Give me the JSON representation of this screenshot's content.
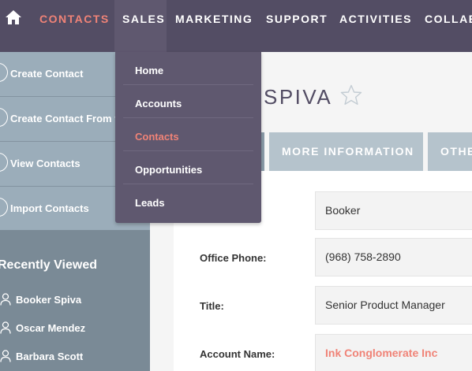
{
  "nav": {
    "items": [
      {
        "label": "CONTACTS"
      },
      {
        "label": "SALES"
      },
      {
        "label": "MARKETING"
      },
      {
        "label": "SUPPORT"
      },
      {
        "label": "ACTIVITIES"
      },
      {
        "label": "COLLAB"
      }
    ],
    "home_icon": "home-icon"
  },
  "sales_menu": {
    "items": [
      {
        "label": "Home"
      },
      {
        "label": "Accounts"
      },
      {
        "label": "Contacts"
      },
      {
        "label": "Opportunities"
      },
      {
        "label": "Leads"
      }
    ],
    "active": "Contacts"
  },
  "sidebar": {
    "actions": [
      {
        "label": "Create Contact"
      },
      {
        "label": "Create Contact From vCard"
      },
      {
        "label": "View Contacts"
      },
      {
        "label": "Import Contacts"
      }
    ],
    "recently_viewed_title": "Recently Viewed",
    "recently_viewed": [
      {
        "label": "Booker Spiva"
      },
      {
        "label": "Oscar Mendez"
      },
      {
        "label": "Barbara Scott"
      }
    ]
  },
  "record": {
    "title": "R SPIVA",
    "tabs": [
      {
        "label": ""
      },
      {
        "label": "MORE INFORMATION"
      },
      {
        "label": "OTHER"
      }
    ],
    "fields": [
      {
        "label": "",
        "value": "Booker"
      },
      {
        "label": "Office Phone:",
        "value": "(968) 758-2890"
      },
      {
        "label": "Title:",
        "value": "Senior Product Manager"
      },
      {
        "label": "Account Name:",
        "value": "Ink Conglomerate Inc"
      }
    ]
  },
  "colors": {
    "nav_bg": "#534d64",
    "accent": "#f08377",
    "sidebar_actions_bg": "#9badba",
    "sidebar_bg": "#7a8a96",
    "dropdown_bg": "#5f586f"
  }
}
